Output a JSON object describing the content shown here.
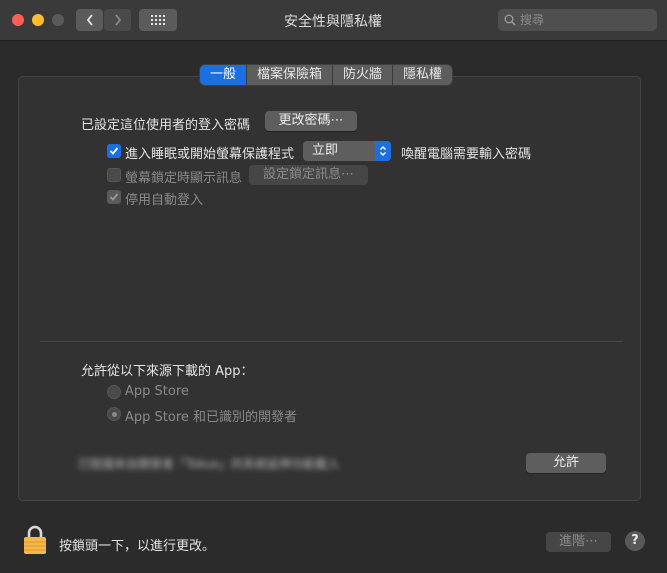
{
  "window": {
    "title": "安全性與隱私權"
  },
  "search": {
    "placeholder": "搜尋"
  },
  "tabs": [
    {
      "label": "一般",
      "active": true
    },
    {
      "label": "檔案保險箱",
      "active": false
    },
    {
      "label": "防火牆",
      "active": false
    },
    {
      "label": "隱私權",
      "active": false
    }
  ],
  "general": {
    "password_label": "已設定這位使用者的登入密碼",
    "change_password_button": "更改密碼⋯",
    "require_password": {
      "checked": true,
      "label": "進入睡眠或開始螢幕保護程式",
      "delay_value": "立即",
      "suffix": "喚醒電腦需要輸入密碼"
    },
    "lock_message": {
      "checked": false,
      "enabled": false,
      "label": "螢幕鎖定時顯示訊息",
      "button": "設定鎖定訊息⋯"
    },
    "disable_auto_login": {
      "checked": true,
      "enabled": false,
      "label": "停用自動登入"
    }
  },
  "downloads": {
    "heading": "允許從以下來源下載的 App：",
    "options": [
      {
        "label": "App Store",
        "selected": false
      },
      {
        "label": "App Store 和已識別的開發者",
        "selected": true
      }
    ],
    "blocked_message": "已阻擋來自開發者「Tokus」的系統延伸功能載入",
    "allow_button": "允許"
  },
  "footer": {
    "lock_text": "按鎖頭一下，以進行更改。",
    "advanced_button": "進階⋯",
    "help_button": "?"
  },
  "colors": {
    "accent": "#1b6fe0",
    "window_bg": "#2b2b2b",
    "panel_bg": "#323232",
    "lock_color": "#f2b84b"
  }
}
